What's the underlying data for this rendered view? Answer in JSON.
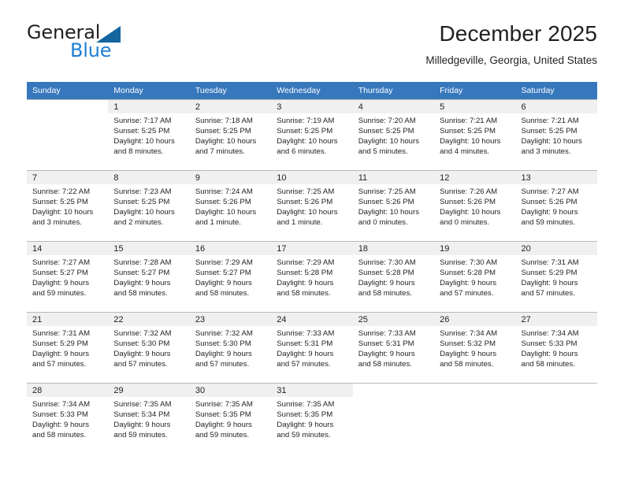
{
  "brand": {
    "name_top": "General",
    "name_bottom": "Blue",
    "accent_color": "#1f7fd4",
    "triangle_color": "#15659f"
  },
  "header": {
    "title": "December 2025",
    "location": "Milledgeville, Georgia, United States"
  },
  "calendar": {
    "header_bg": "#3778bd",
    "weekday_headers": [
      "Sunday",
      "Monday",
      "Tuesday",
      "Wednesday",
      "Thursday",
      "Friday",
      "Saturday"
    ],
    "weeks": [
      [
        {
          "day": "",
          "sunrise": "",
          "sunset": "",
          "daylight": "",
          "empty": true
        },
        {
          "day": "1",
          "sunrise": "Sunrise: 7:17 AM",
          "sunset": "Sunset: 5:25 PM",
          "daylight": "Daylight: 10 hours and 8 minutes."
        },
        {
          "day": "2",
          "sunrise": "Sunrise: 7:18 AM",
          "sunset": "Sunset: 5:25 PM",
          "daylight": "Daylight: 10 hours and 7 minutes."
        },
        {
          "day": "3",
          "sunrise": "Sunrise: 7:19 AM",
          "sunset": "Sunset: 5:25 PM",
          "daylight": "Daylight: 10 hours and 6 minutes."
        },
        {
          "day": "4",
          "sunrise": "Sunrise: 7:20 AM",
          "sunset": "Sunset: 5:25 PM",
          "daylight": "Daylight: 10 hours and 5 minutes."
        },
        {
          "day": "5",
          "sunrise": "Sunrise: 7:21 AM",
          "sunset": "Sunset: 5:25 PM",
          "daylight": "Daylight: 10 hours and 4 minutes."
        },
        {
          "day": "6",
          "sunrise": "Sunrise: 7:21 AM",
          "sunset": "Sunset: 5:25 PM",
          "daylight": "Daylight: 10 hours and 3 minutes."
        }
      ],
      [
        {
          "day": "7",
          "sunrise": "Sunrise: 7:22 AM",
          "sunset": "Sunset: 5:25 PM",
          "daylight": "Daylight: 10 hours and 3 minutes."
        },
        {
          "day": "8",
          "sunrise": "Sunrise: 7:23 AM",
          "sunset": "Sunset: 5:25 PM",
          "daylight": "Daylight: 10 hours and 2 minutes."
        },
        {
          "day": "9",
          "sunrise": "Sunrise: 7:24 AM",
          "sunset": "Sunset: 5:26 PM",
          "daylight": "Daylight: 10 hours and 1 minute."
        },
        {
          "day": "10",
          "sunrise": "Sunrise: 7:25 AM",
          "sunset": "Sunset: 5:26 PM",
          "daylight": "Daylight: 10 hours and 1 minute."
        },
        {
          "day": "11",
          "sunrise": "Sunrise: 7:25 AM",
          "sunset": "Sunset: 5:26 PM",
          "daylight": "Daylight: 10 hours and 0 minutes."
        },
        {
          "day": "12",
          "sunrise": "Sunrise: 7:26 AM",
          "sunset": "Sunset: 5:26 PM",
          "daylight": "Daylight: 10 hours and 0 minutes."
        },
        {
          "day": "13",
          "sunrise": "Sunrise: 7:27 AM",
          "sunset": "Sunset: 5:26 PM",
          "daylight": "Daylight: 9 hours and 59 minutes."
        }
      ],
      [
        {
          "day": "14",
          "sunrise": "Sunrise: 7:27 AM",
          "sunset": "Sunset: 5:27 PM",
          "daylight": "Daylight: 9 hours and 59 minutes."
        },
        {
          "day": "15",
          "sunrise": "Sunrise: 7:28 AM",
          "sunset": "Sunset: 5:27 PM",
          "daylight": "Daylight: 9 hours and 58 minutes."
        },
        {
          "day": "16",
          "sunrise": "Sunrise: 7:29 AM",
          "sunset": "Sunset: 5:27 PM",
          "daylight": "Daylight: 9 hours and 58 minutes."
        },
        {
          "day": "17",
          "sunrise": "Sunrise: 7:29 AM",
          "sunset": "Sunset: 5:28 PM",
          "daylight": "Daylight: 9 hours and 58 minutes."
        },
        {
          "day": "18",
          "sunrise": "Sunrise: 7:30 AM",
          "sunset": "Sunset: 5:28 PM",
          "daylight": "Daylight: 9 hours and 58 minutes."
        },
        {
          "day": "19",
          "sunrise": "Sunrise: 7:30 AM",
          "sunset": "Sunset: 5:28 PM",
          "daylight": "Daylight: 9 hours and 57 minutes."
        },
        {
          "day": "20",
          "sunrise": "Sunrise: 7:31 AM",
          "sunset": "Sunset: 5:29 PM",
          "daylight": "Daylight: 9 hours and 57 minutes."
        }
      ],
      [
        {
          "day": "21",
          "sunrise": "Sunrise: 7:31 AM",
          "sunset": "Sunset: 5:29 PM",
          "daylight": "Daylight: 9 hours and 57 minutes."
        },
        {
          "day": "22",
          "sunrise": "Sunrise: 7:32 AM",
          "sunset": "Sunset: 5:30 PM",
          "daylight": "Daylight: 9 hours and 57 minutes."
        },
        {
          "day": "23",
          "sunrise": "Sunrise: 7:32 AM",
          "sunset": "Sunset: 5:30 PM",
          "daylight": "Daylight: 9 hours and 57 minutes."
        },
        {
          "day": "24",
          "sunrise": "Sunrise: 7:33 AM",
          "sunset": "Sunset: 5:31 PM",
          "daylight": "Daylight: 9 hours and 57 minutes."
        },
        {
          "day": "25",
          "sunrise": "Sunrise: 7:33 AM",
          "sunset": "Sunset: 5:31 PM",
          "daylight": "Daylight: 9 hours and 58 minutes."
        },
        {
          "day": "26",
          "sunrise": "Sunrise: 7:34 AM",
          "sunset": "Sunset: 5:32 PM",
          "daylight": "Daylight: 9 hours and 58 minutes."
        },
        {
          "day": "27",
          "sunrise": "Sunrise: 7:34 AM",
          "sunset": "Sunset: 5:33 PM",
          "daylight": "Daylight: 9 hours and 58 minutes."
        }
      ],
      [
        {
          "day": "28",
          "sunrise": "Sunrise: 7:34 AM",
          "sunset": "Sunset: 5:33 PM",
          "daylight": "Daylight: 9 hours and 58 minutes."
        },
        {
          "day": "29",
          "sunrise": "Sunrise: 7:35 AM",
          "sunset": "Sunset: 5:34 PM",
          "daylight": "Daylight: 9 hours and 59 minutes."
        },
        {
          "day": "30",
          "sunrise": "Sunrise: 7:35 AM",
          "sunset": "Sunset: 5:35 PM",
          "daylight": "Daylight: 9 hours and 59 minutes."
        },
        {
          "day": "31",
          "sunrise": "Sunrise: 7:35 AM",
          "sunset": "Sunset: 5:35 PM",
          "daylight": "Daylight: 9 hours and 59 minutes."
        },
        {
          "day": "",
          "sunrise": "",
          "sunset": "",
          "daylight": "",
          "empty": true
        },
        {
          "day": "",
          "sunrise": "",
          "sunset": "",
          "daylight": "",
          "empty": true
        },
        {
          "day": "",
          "sunrise": "",
          "sunset": "",
          "daylight": "",
          "empty": true
        }
      ]
    ]
  }
}
